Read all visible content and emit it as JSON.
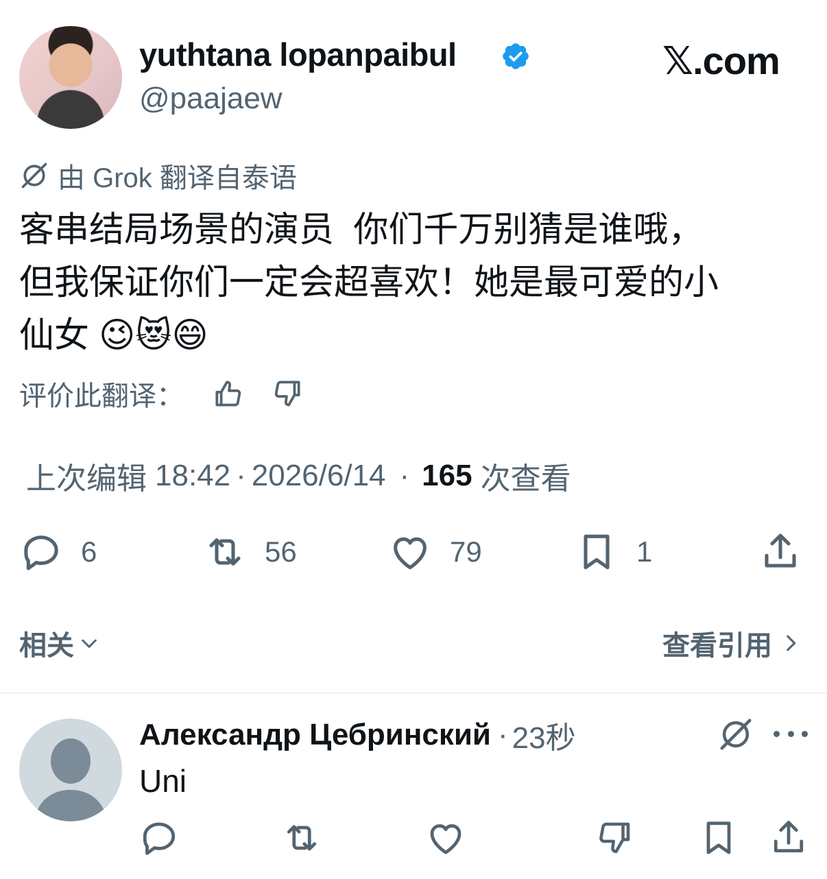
{
  "author": {
    "display_name": "yuthtana lopanpaibul",
    "handle": "@paajaew",
    "verified": true
  },
  "brand": "𝕏.com",
  "translation_note": "由 Grok 翻译自泰语",
  "post_text": "客串结局场景的演员  你们千万别猜是谁哦，\n但我保证你们一定会超喜欢！她是最可爱的小\n仙女 😉😻😄",
  "rate_label": "评价此翻译：",
  "meta": {
    "edited_label": "上次编辑",
    "time": "18:42",
    "separator": "·",
    "date": "2026/6/14",
    "views_count": "165",
    "views_label": "次查看"
  },
  "actions": {
    "replies": "6",
    "reposts": "56",
    "likes": "79",
    "bookmarks": "1"
  },
  "related_label": "相关",
  "view_quotes_label": "查看引用",
  "reply": {
    "display_name": "Александр Цебринский",
    "separator": "·",
    "time": "23秒",
    "text": "Uni"
  },
  "colors": {
    "text": "#0f1419",
    "secondary": "#536471",
    "verified": "#1d9bf0",
    "divider": "#eff3f4"
  },
  "icons": [
    "verified-badge-icon",
    "grok-icon",
    "thumbs-up-icon",
    "thumbs-down-icon",
    "reply-icon",
    "repost-icon",
    "like-icon",
    "bookmark-icon",
    "share-icon",
    "chevron-down-icon",
    "chevron-right-icon",
    "more-icon",
    "default-avatar-icon"
  ]
}
